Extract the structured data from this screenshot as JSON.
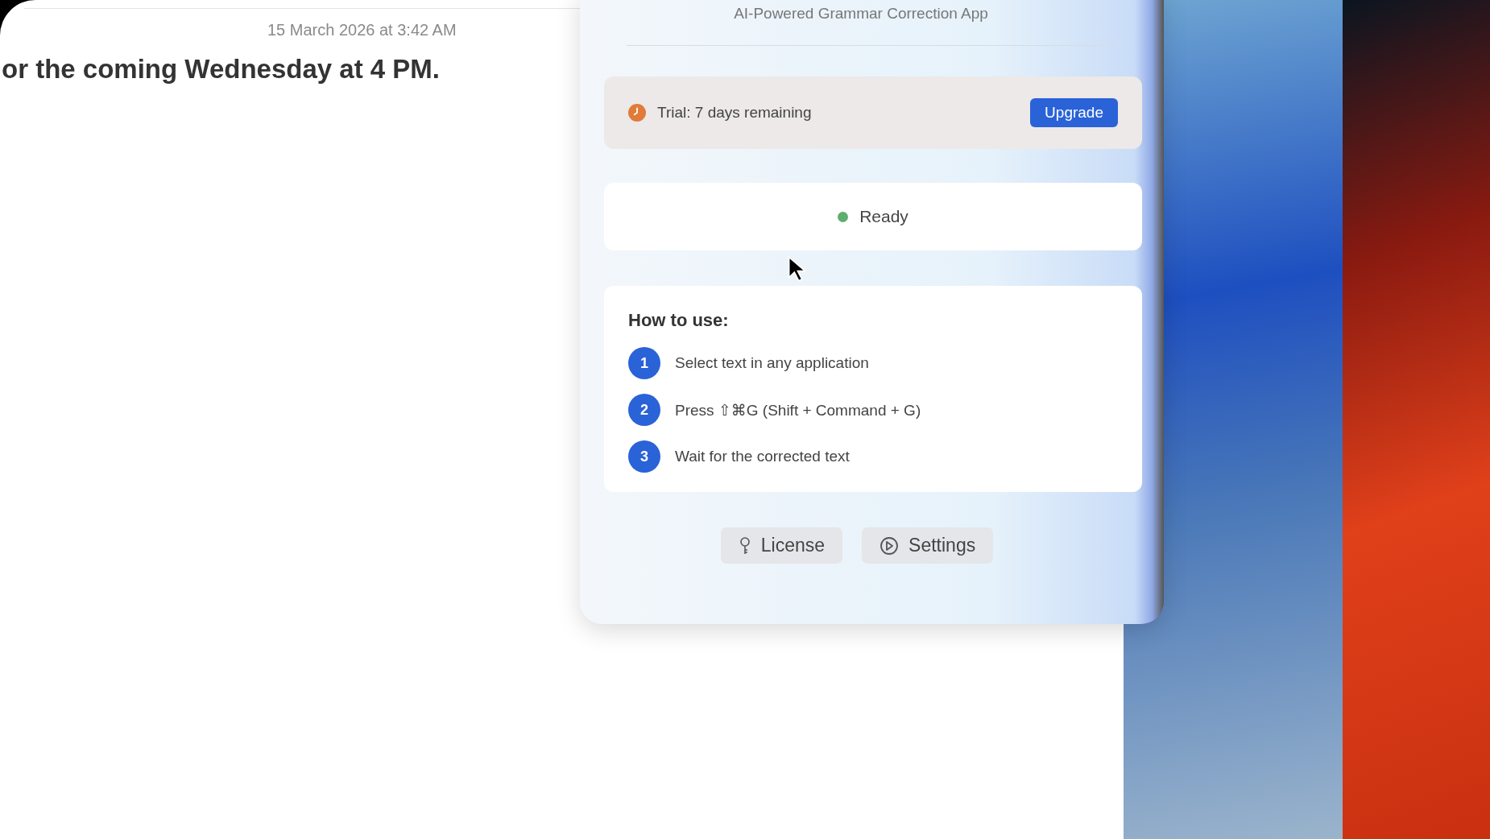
{
  "document": {
    "timestamp": "15 March 2026 at 3:42 AM",
    "body": "or the coming Wednesday at 4 PM."
  },
  "panel": {
    "subtitle": "AI-Powered Grammar Correction App",
    "trial": {
      "label": "Trial: 7 days remaining",
      "button": "Upgrade"
    },
    "status": {
      "label": "Ready"
    },
    "how_to": {
      "title": "How to use:",
      "steps": [
        {
          "number": "1",
          "text": "Select text in any application"
        },
        {
          "number": "2",
          "text": "Press ⇧⌘G (Shift + Command + G)"
        },
        {
          "number": "3",
          "text": "Wait for the corrected text"
        }
      ]
    },
    "buttons": [
      {
        "kind": "license",
        "label": "License"
      },
      {
        "kind": "settings",
        "label": "Settings"
      }
    ]
  }
}
